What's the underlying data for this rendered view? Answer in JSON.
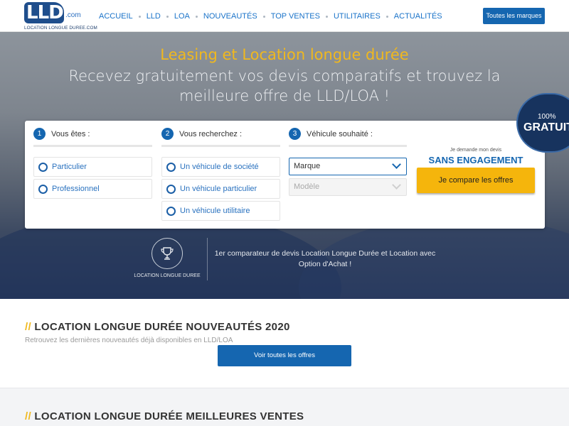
{
  "nav": {
    "logo_text": "LLD",
    "logo_dotcom": ".com",
    "logo_sub": "LOCATION LONGUE DUREE.COM",
    "items": [
      "ACCUEIL",
      "LLD",
      "LOA",
      "NOUVEAUTÉS",
      "TOP VENTES",
      "UTILITAIRES",
      "ACTUALITÉS"
    ],
    "brands_button": "Toutes les marques"
  },
  "hero": {
    "title": "Leasing et Location longue durée",
    "subtitle": "Recevez gratuitement vos devis comparatifs et trouvez la meilleure offre de LLD/LOA !",
    "badge_pct": "100%",
    "badge_free": "GRATUIT",
    "trophy_label": "LOCATION LONGUE DUREE",
    "note": "1er comparateur de devis Location Longue Durée et Location avec Option d'Achat !"
  },
  "form": {
    "step1": {
      "num": "1",
      "label": "Vous êtes :",
      "options": [
        "Particulier",
        "Professionnel"
      ]
    },
    "step2": {
      "num": "2",
      "label": "Vous recherchez :",
      "options": [
        "Un véhicule de société",
        "Un véhicule particulier",
        "Un véhicule utilitaire"
      ]
    },
    "step3": {
      "num": "3",
      "label": "Véhicule souhaité :",
      "brand_select": "Marque",
      "model_select": "Modèle"
    },
    "cta_pre": "Je demande mon devis",
    "cta_engagement": "SANS ENGAGEMENT",
    "cta_button": "Je compare les offres"
  },
  "section1": {
    "slashes": "//",
    "title": "LOCATION LONGUE DURÉE NOUVEAUTÉS 2020",
    "subtitle": "Retrouvez les dernières nouveautés déjà disponibles en LLD/LOA",
    "button": "Voir toutes les offres"
  },
  "section2": {
    "slashes": "//",
    "title": "LOCATION LONGUE DURÉE MEILLEURES VENTES"
  }
}
